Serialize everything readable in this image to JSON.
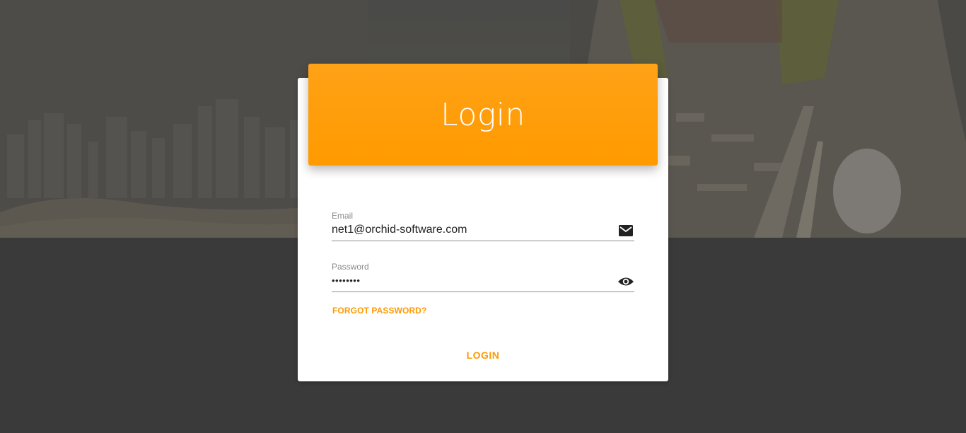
{
  "login": {
    "title": "Login",
    "email": {
      "label": "Email",
      "value": "net1@orchid-software.com",
      "icon": "mail-icon"
    },
    "password": {
      "label": "Password",
      "value": "••••••••",
      "icon": "eye-icon"
    },
    "forgot_password_label": "FORGOT PASSWORD?",
    "login_button_label": "LOGIN"
  },
  "colors": {
    "accent": "#ff9a00",
    "page_background": "#3a3a3a",
    "card_background": "#ffffff"
  }
}
